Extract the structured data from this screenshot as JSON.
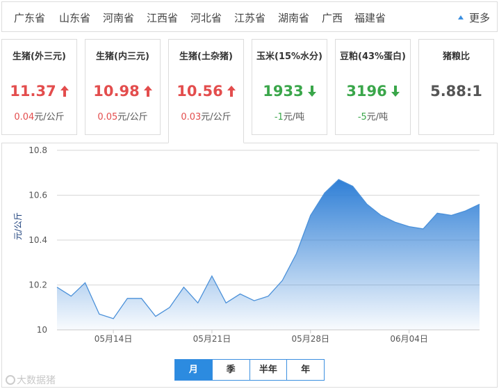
{
  "provinces": [
    "广东省",
    "山东省",
    "河南省",
    "江西省",
    "河北省",
    "江苏省",
    "湖南省",
    "广西",
    "福建省"
  ],
  "more_label": "更多",
  "cards": [
    {
      "name": "生猪(外三元)",
      "price": "11.37",
      "change": "0.04",
      "unit": "元/公斤",
      "direction": "up"
    },
    {
      "name": "生猪(内三元)",
      "price": "10.98",
      "change": "0.05",
      "unit": "元/公斤",
      "direction": "up"
    },
    {
      "name": "生猪(土杂猪)",
      "price": "10.56",
      "change": "0.03",
      "unit": "元/公斤",
      "direction": "up"
    },
    {
      "name": "玉米(15%水分)",
      "price": "1933",
      "change": "-1",
      "unit": "元/吨",
      "direction": "down"
    },
    {
      "name": "豆粕(43%蛋白)",
      "price": "3196",
      "change": "-5",
      "unit": "元/吨",
      "direction": "down"
    },
    {
      "name": "猪粮比",
      "price": "5.88:1",
      "change": "",
      "unit": "",
      "direction": "none"
    }
  ],
  "active_card": 2,
  "tabs": [
    "月",
    "季",
    "半年",
    "年"
  ],
  "active_tab": 0,
  "watermark": "大数据猪",
  "colors": {
    "accent": "#2c8be0",
    "up": "#e34d4d",
    "down": "#3aa64a",
    "area_top": "#2f7fd6"
  },
  "chart_data": {
    "type": "area",
    "ylabel": "元/公斤",
    "ylim": [
      10,
      10.8
    ],
    "yticks": [
      "10",
      "10.2",
      "10.4",
      "10.6",
      "10.8"
    ],
    "xticks": [
      "05月14日",
      "05月21日",
      "05月28日",
      "06月04日"
    ],
    "x": [
      "05月10日",
      "05月11日",
      "05月12日",
      "05月13日",
      "05月14日",
      "05月15日",
      "05月16日",
      "05月17日",
      "05月18日",
      "05月19日",
      "05月20日",
      "05月21日",
      "05月22日",
      "05月23日",
      "05月24日",
      "05月25日",
      "05月26日",
      "05月27日",
      "05月28日",
      "05月29日",
      "05月30日",
      "05月31日",
      "06月01日",
      "06月02日",
      "06月03日",
      "06月04日",
      "06月05日",
      "06月06日",
      "06月07日",
      "06月08日"
    ],
    "values": [
      10.19,
      10.15,
      10.21,
      10.07,
      10.05,
      10.14,
      10.14,
      10.06,
      10.1,
      10.19,
      10.12,
      10.24,
      10.12,
      10.16,
      10.13,
      10.15,
      10.22,
      10.34,
      10.51,
      10.61,
      10.67,
      10.64,
      10.56,
      10.51,
      10.48,
      10.46,
      10.45,
      10.52,
      10.51,
      10.53,
      10.56
    ],
    "grid": true
  }
}
